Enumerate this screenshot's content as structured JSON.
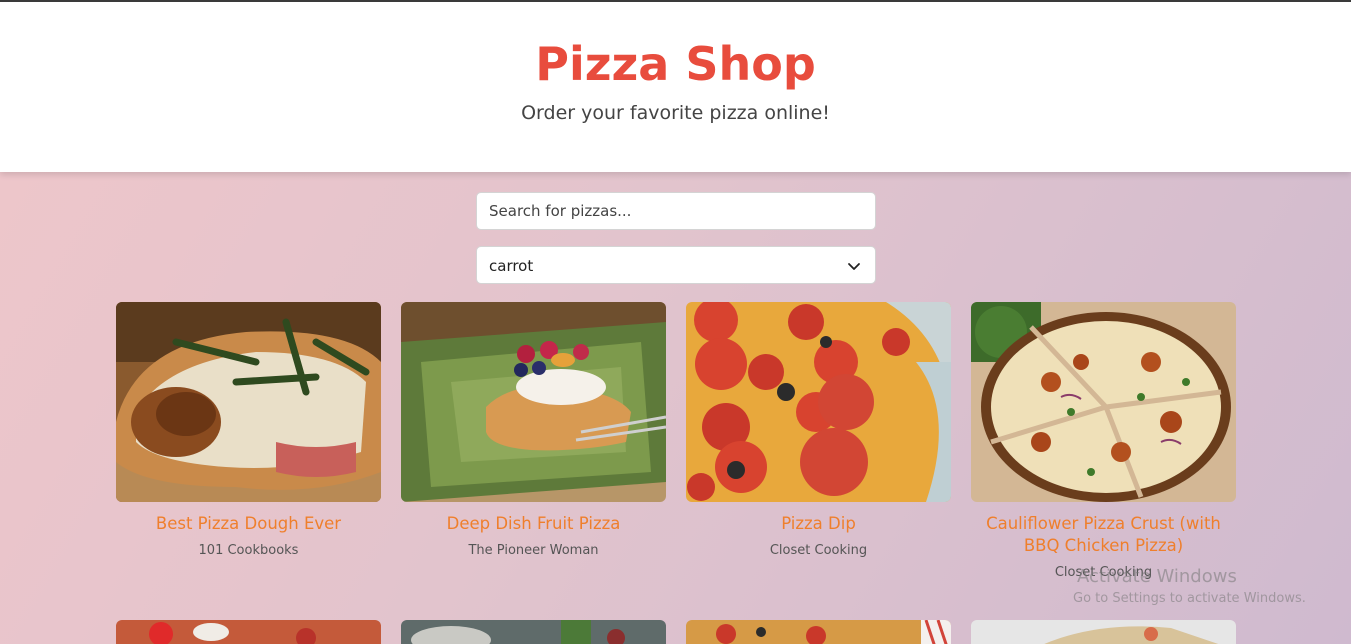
{
  "header": {
    "title": "Pizza Shop",
    "subtitle": "Order your favorite pizza online!"
  },
  "search": {
    "placeholder": "Search for pizzas..."
  },
  "filter": {
    "selected": "carrot"
  },
  "recipes": [
    {
      "title": "Best Pizza Dough Ever",
      "publisher": "101 Cookbooks"
    },
    {
      "title": "Deep Dish Fruit Pizza",
      "publisher": "The Pioneer Woman"
    },
    {
      "title": "Pizza Dip",
      "publisher": "Closet Cooking"
    },
    {
      "title": "Cauliflower Pizza Crust (with BBQ Chicken Pizza)",
      "publisher": "Closet Cooking"
    }
  ],
  "watermark": {
    "line1": "Activate Windows",
    "line2": "Go to Settings to activate Windows."
  },
  "colors": {
    "accent": "#e84c3d",
    "card_title": "#ef7f2c"
  }
}
